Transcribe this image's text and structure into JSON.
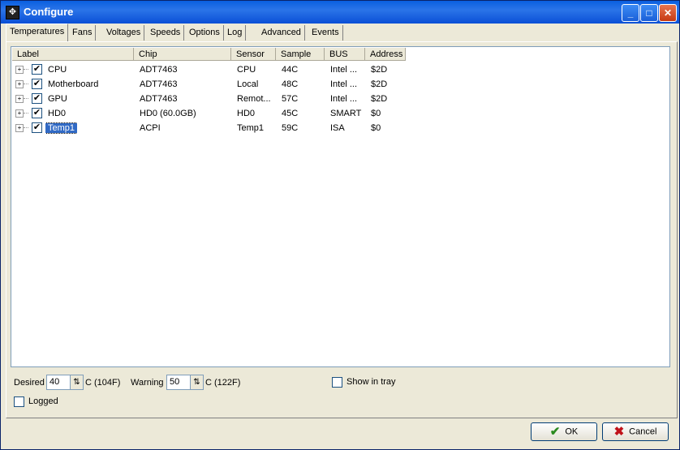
{
  "window": {
    "title": "Configure"
  },
  "tabs": [
    {
      "label": "Temperatures",
      "active": true
    },
    {
      "label": "Fans"
    },
    {
      "label": "Voltages"
    },
    {
      "label": "Speeds"
    },
    {
      "label": "Options"
    },
    {
      "label": "Log"
    },
    {
      "label": "Advanced"
    },
    {
      "label": "Events"
    }
  ],
  "table": {
    "columns": [
      "Label",
      "Chip",
      "Sensor",
      "Sample",
      "BUS",
      "Address"
    ],
    "rows": [
      {
        "label": "CPU",
        "chip": "ADT7463",
        "sensor": "CPU",
        "sample": "44C",
        "bus": "Intel ...",
        "address": "$2D",
        "checked": true
      },
      {
        "label": "Motherboard",
        "chip": "ADT7463",
        "sensor": "Local",
        "sample": "48C",
        "bus": "Intel ...",
        "address": "$2D",
        "checked": true
      },
      {
        "label": "GPU",
        "chip": "ADT7463",
        "sensor": "Remot...",
        "sample": "57C",
        "bus": "Intel ...",
        "address": "$2D",
        "checked": true
      },
      {
        "label": "HD0",
        "chip": "HD0 (60.0GB)",
        "sensor": "HD0",
        "sample": "45C",
        "bus": "SMART",
        "address": "$0",
        "checked": true
      },
      {
        "label": "Temp1",
        "chip": "ACPI",
        "sensor": "Temp1",
        "sample": "59C",
        "bus": "ISA",
        "address": "$0",
        "checked": true,
        "selected": true
      }
    ]
  },
  "settings": {
    "desired_label": "Desired",
    "desired_value": "40",
    "desired_unit": "C (104F)",
    "warning_label": "Warning",
    "warning_value": "50",
    "warning_unit": "C (122F)",
    "show_in_tray_label": "Show in tray",
    "show_in_tray_checked": false,
    "logged_label": "Logged",
    "logged_checked": false
  },
  "buttons": {
    "ok": "OK",
    "cancel": "Cancel"
  },
  "icons": {
    "check_mark": "✔",
    "expander": "+",
    "spin": "⇅",
    "ok_icon": "green-check-icon",
    "cancel_icon": "red-x-icon"
  },
  "colors": {
    "title_bar": "#0a5fe0",
    "selection": "#316ac5",
    "ok_icon": "#2a8a1f",
    "cancel_icon": "#c0121a"
  }
}
